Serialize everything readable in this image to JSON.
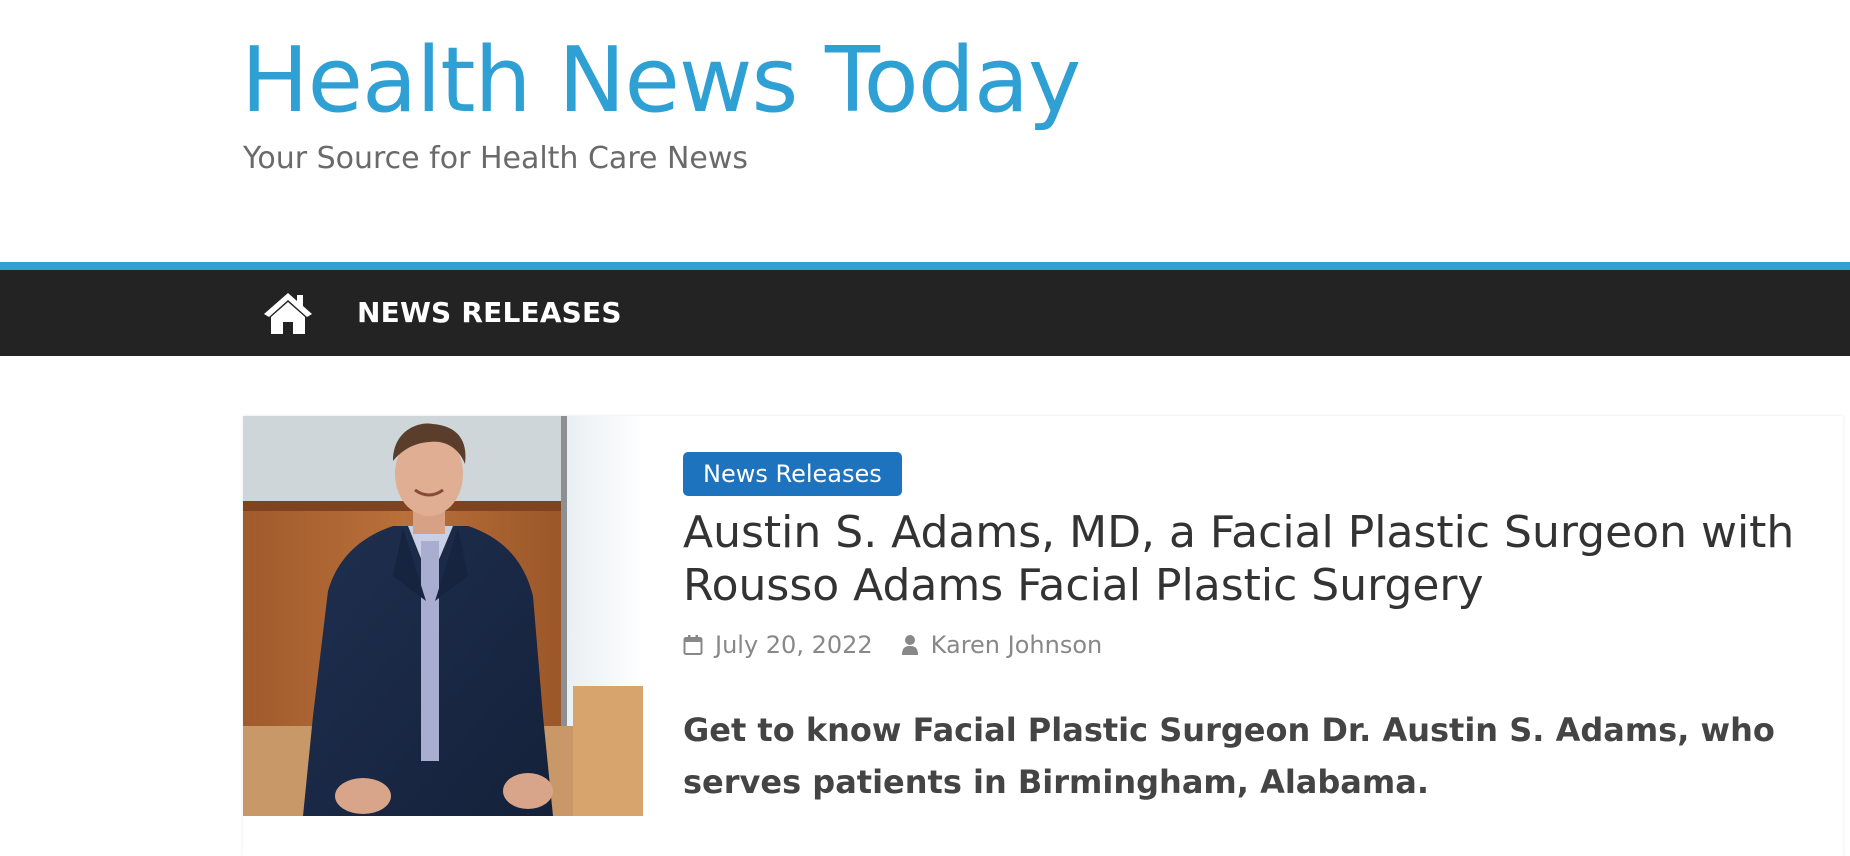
{
  "site": {
    "title": "Health News Today",
    "tagline": "Your Source for Health Care News"
  },
  "nav": {
    "home_icon": "home-icon",
    "items": [
      {
        "label": "NEWS RELEASES"
      }
    ]
  },
  "post": {
    "image_alt": "Dr. Austin S. Adams portrait",
    "category": "News Releases",
    "title": "Austin S. Adams, MD, a Facial Plastic Surgeon with Rousso Adams Facial Plastic Surgery",
    "date": "July 20, 2022",
    "author": "Karen Johnson",
    "excerpt": "Get to know Facial Plastic Surgeon Dr. Austin S. Adams, who serves patients in Birmingham, Alabama.",
    "date_icon": "calendar-icon",
    "author_icon": "user-icon"
  },
  "colors": {
    "brand": "#2fa0d4",
    "nav_background": "#232323",
    "badge": "#1e73be"
  }
}
